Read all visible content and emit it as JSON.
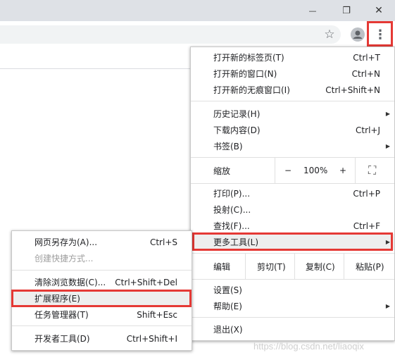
{
  "window_controls": {
    "minimize_glyph": "—",
    "restore_glyph": "❐",
    "close_glyph": "✕"
  },
  "toolbar": {
    "star_glyph": "☆",
    "menu_glyph": "⋮"
  },
  "main_menu": {
    "new_tab": {
      "label": "打开新的标签页(T)",
      "shortcut": "Ctrl+T"
    },
    "new_window": {
      "label": "打开新的窗口(N)",
      "shortcut": "Ctrl+N"
    },
    "new_incognito": {
      "label": "打开新的无痕窗口(I)",
      "shortcut": "Ctrl+Shift+N"
    },
    "history": {
      "label": "历史记录(H)"
    },
    "downloads": {
      "label": "下载内容(D)",
      "shortcut": "Ctrl+J"
    },
    "bookmarks": {
      "label": "书签(B)"
    },
    "zoom": {
      "label": "缩放",
      "minus": "−",
      "value": "100%",
      "plus": "+",
      "fullscreen_glyph": "⛶"
    },
    "print": {
      "label": "打印(P)...",
      "shortcut": "Ctrl+P"
    },
    "cast": {
      "label": "投射(C)..."
    },
    "find": {
      "label": "查找(F)...",
      "shortcut": "Ctrl+F"
    },
    "more_tools": {
      "label": "更多工具(L)"
    },
    "edit": {
      "label": "编辑",
      "cut": "剪切(T)",
      "copy": "复制(C)",
      "paste": "粘贴(P)"
    },
    "settings": {
      "label": "设置(S)"
    },
    "help": {
      "label": "帮助(E)"
    },
    "exit": {
      "label": "退出(X)"
    }
  },
  "submenu": {
    "save_page": {
      "label": "网页另存为(A)...",
      "shortcut": "Ctrl+S"
    },
    "create_shortcut": {
      "label": "创建快捷方式..."
    },
    "clear_data": {
      "label": "清除浏览数据(C)...",
      "shortcut": "Ctrl+Shift+Del"
    },
    "extensions": {
      "label": "扩展程序(E)"
    },
    "task_manager": {
      "label": "任务管理器(T)",
      "shortcut": "Shift+Esc"
    },
    "dev_tools": {
      "label": "开发者工具(D)",
      "shortcut": "Ctrl+Shift+I"
    }
  },
  "watermark": "https://blog.csdn.net/liaoqix",
  "colors": {
    "highlight_box": "#e53935",
    "titlebar": "#dee1e6",
    "hover": "#eeeeee"
  }
}
